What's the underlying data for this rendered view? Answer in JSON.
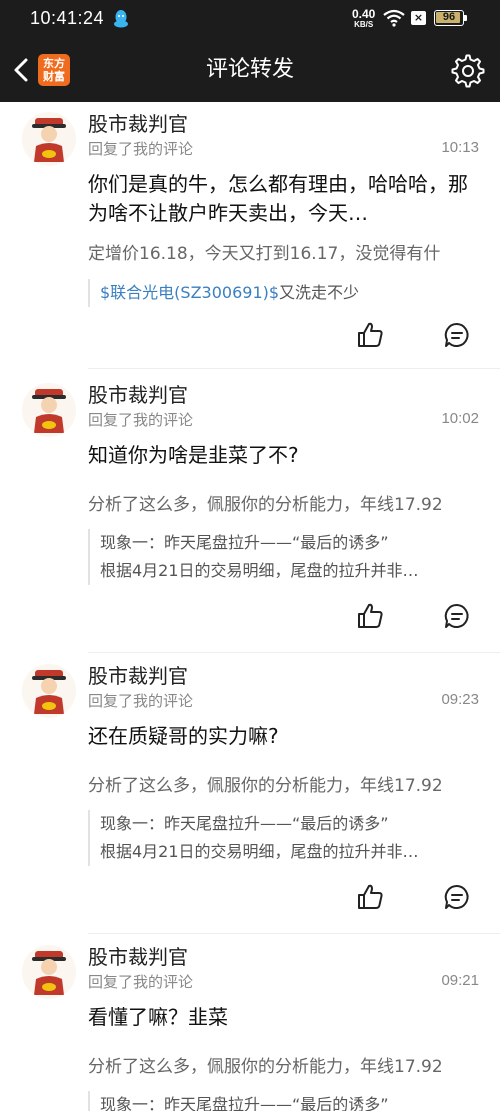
{
  "status_bar": {
    "time": "10:41:24",
    "net_speed": "0.40",
    "net_speed_unit": "KB/S",
    "sim_badge": "×",
    "battery": "96",
    "battery_level": 0.96,
    "battery_color": "#c9b16d"
  },
  "header": {
    "title": "评论转发",
    "logo_line1": "东方",
    "logo_line2": "财富",
    "logo_color": "#ef6c1f"
  },
  "feed": {
    "items": [
      {
        "author": "股市裁判官",
        "action": "回复了我的评论",
        "time": "10:13",
        "comment": "你们是真的牛，怎么都有理由，哈哈哈，那为啥不让散户昨天卖出，今天…",
        "excerpt": "定增价16.18，今天又打到16.17，没觉得有什",
        "quote_link": "$联合光电(SZ300691)$",
        "quote_rest": "又洗走不少"
      },
      {
        "author": "股市裁判官",
        "action": "回复了我的评论",
        "time": "10:02",
        "comment": "知道你为啥是韭菜了不?",
        "excerpt": "分析了这么多，佩服你的分析能力，年线17.92",
        "quote_line1": "现象一：昨天尾盘拉升——“最后的诱多”",
        "quote_line2": "根据4月21日的交易明细，尾盘的拉升并非…"
      },
      {
        "author": "股市裁判官",
        "action": "回复了我的评论",
        "time": "09:23",
        "comment": "还在质疑哥的实力嘛?",
        "excerpt": "分析了这么多，佩服你的分析能力，年线17.92",
        "quote_line1": "现象一：昨天尾盘拉升——“最后的诱多”",
        "quote_line2": "根据4月21日的交易明细，尾盘的拉升并非…"
      },
      {
        "author": "股市裁判官",
        "action": "回复了我的评论",
        "time": "09:21",
        "comment": "看懂了嘛？韭菜",
        "excerpt": "分析了这么多，佩服你的分析能力，年线17.92",
        "quote_line1": "现象一：昨天尾盘拉升——“最后的诱多”"
      }
    ]
  },
  "colors": {
    "link": "#3a7fc1",
    "header_bg": "#1c1c1c"
  }
}
